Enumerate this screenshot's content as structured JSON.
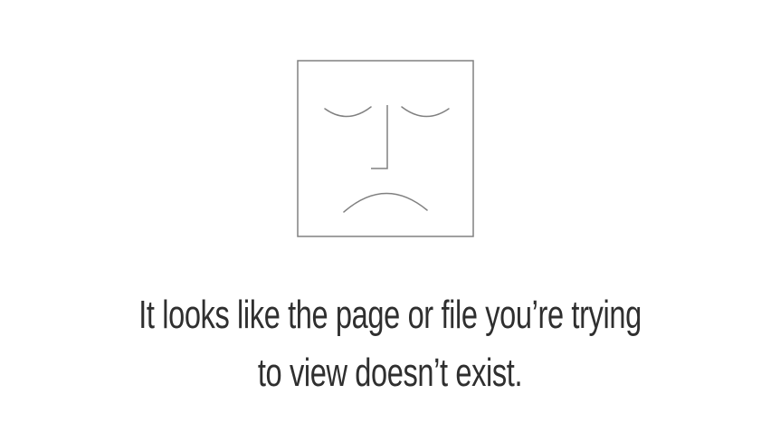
{
  "error_page": {
    "icon": "sad-face-icon",
    "message_line_1": "It looks like the page or file you’re trying",
    "message_line_2": "to view doesn’t exist."
  },
  "colors": {
    "background": "#ffffff",
    "icon_stroke": "#808080",
    "text": "#2f2f2f"
  }
}
